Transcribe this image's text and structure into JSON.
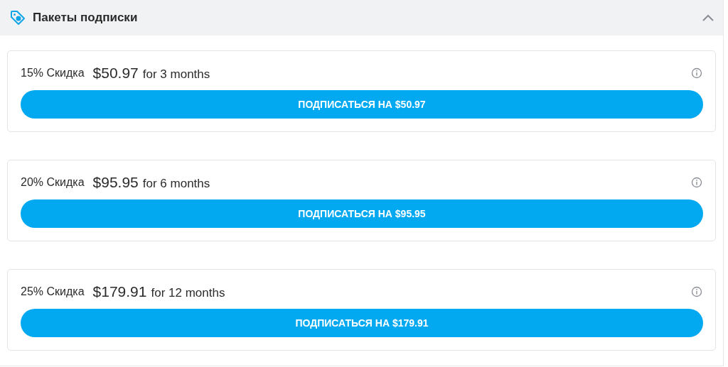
{
  "section": {
    "title": "Пакеты подписки",
    "expanded": true
  },
  "packages": [
    {
      "discount": "15% Скидка",
      "price": "$50.97",
      "term": "for 3 months",
      "button": "ПОДПИСАТЬСЯ НА $50.97"
    },
    {
      "discount": "20% Скидка",
      "price": "$95.95",
      "term": "for 6 months",
      "button": "ПОДПИСАТЬСЯ НА $95.95"
    },
    {
      "discount": "25% Скидка",
      "price": "$179.91",
      "term": "for 12 months",
      "button": "ПОДПИСАТЬСЯ НА $179.91"
    }
  ]
}
